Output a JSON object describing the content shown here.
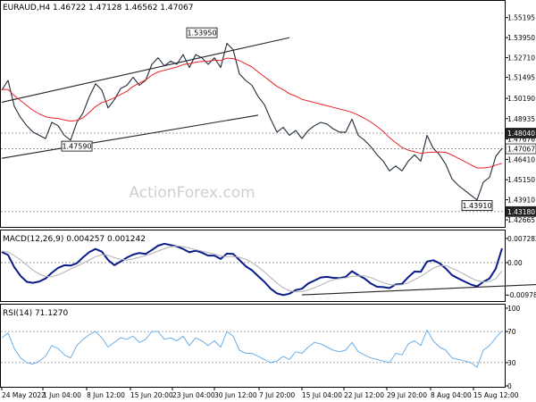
{
  "chart_data": [
    {
      "type": "line",
      "panel": "price",
      "title": "EURAUD,H4 1.46722 1.47128 1.46562 1.47067",
      "watermark": "ActionForex.com",
      "ylim": [
        1.4245,
        1.5595
      ],
      "y_ticks": [
        "1.55195",
        "1.53950",
        "1.52710",
        "1.51495",
        "1.50190",
        "1.48935",
        "1.47676",
        "1.46410",
        "1.45150",
        "1.43910",
        "1.42665"
      ],
      "level_labels": [
        {
          "value": 1.4804,
          "text": "1.48040",
          "style": "dark"
        },
        {
          "value": 1.47067,
          "text": "1.47067",
          "style": "light"
        },
        {
          "value": 1.4318,
          "text": "1.43180",
          "style": "dark"
        }
      ],
      "horizontal_lines": [
        1.4804,
        1.47067,
        1.4318
      ],
      "annotations": [
        {
          "text": "1.53950",
          "x": 32,
          "value": 1.5395
        },
        {
          "text": "1.47590",
          "x": 12,
          "value": 1.4759
        },
        {
          "text": "1.43910",
          "x": 76,
          "value": 1.4391
        }
      ],
      "trendlines": [
        {
          "x": [
            0,
            46
          ],
          "y": [
            1.4995,
            1.5395
          ]
        },
        {
          "x": [
            0,
            41
          ],
          "y": [
            1.4648,
            1.4915
          ]
        }
      ],
      "x_labels": [
        "24 May 2022",
        "1 Jun 04:00",
        "8 Jun 12:00",
        "15 Jun 20:00",
        "23 Jun 04:00",
        "30 Jun 12:00",
        "7 Jul 20:00",
        "15 Jul 04:00",
        "22 Jul 12:00",
        "29 Jul 20:00",
        "8 Aug 04:00",
        "15 Aug 12:00"
      ],
      "series": [
        {
          "name": "EURAUD",
          "color": "#1f2b3b",
          "values": [
            1.507,
            1.513,
            1.497,
            1.49,
            1.485,
            1.481,
            1.479,
            1.477,
            1.487,
            1.485,
            1.479,
            1.476,
            1.487,
            1.493,
            1.503,
            1.511,
            1.507,
            1.496,
            1.501,
            1.508,
            1.51,
            1.515,
            1.51,
            1.513,
            1.523,
            1.527,
            1.522,
            1.525,
            1.523,
            1.529,
            1.521,
            1.529,
            1.527,
            1.523,
            1.527,
            1.521,
            1.536,
            1.532,
            1.517,
            1.513,
            1.51,
            1.503,
            1.498,
            1.489,
            1.481,
            1.484,
            1.479,
            1.482,
            1.477,
            1.482,
            1.485,
            1.487,
            1.486,
            1.483,
            1.481,
            1.481,
            1.489,
            1.479,
            1.476,
            1.472,
            1.467,
            1.463,
            1.457,
            1.46,
            1.457,
            1.463,
            1.467,
            1.463,
            1.479,
            1.471,
            1.467,
            1.461,
            1.452,
            1.448,
            1.445,
            1.442,
            1.439,
            1.45,
            1.453,
            1.466,
            1.471
          ]
        },
        {
          "name": "MA",
          "color": "#e8222a",
          "values": [
            1.5075,
            1.5074,
            1.5036,
            1.5005,
            1.4975,
            1.4945,
            1.4923,
            1.4905,
            1.4898,
            1.4895,
            1.4885,
            1.4878,
            1.4883,
            1.4898,
            1.4933,
            1.4968,
            1.4993,
            1.5005,
            1.5023,
            1.5043,
            1.5063,
            1.5093,
            1.5113,
            1.5133,
            1.5163,
            1.5183,
            1.5193,
            1.5203,
            1.5213,
            1.5228,
            1.5233,
            1.5243,
            1.5248,
            1.5248,
            1.5256,
            1.5253,
            1.5268,
            1.5265,
            1.5253,
            1.5233,
            1.5213,
            1.5183,
            1.5153,
            1.5123,
            1.5093,
            1.5073,
            1.5048,
            1.5033,
            1.5013,
            1.5003,
            1.4993,
            1.4983,
            1.4973,
            1.4963,
            1.4953,
            1.4943,
            1.4933,
            1.4915,
            1.4895,
            1.4873,
            1.4845,
            1.4815,
            1.4775,
            1.4745,
            1.4715,
            1.4698,
            1.4688,
            1.4678,
            1.4684,
            1.4686,
            1.4687,
            1.4685,
            1.4668,
            1.4648,
            1.4628,
            1.4608,
            1.4588,
            1.4588,
            1.4593,
            1.4606,
            1.4617
          ]
        }
      ]
    },
    {
      "type": "line",
      "panel": "macd",
      "title": "MACD(12,26,9) 0.004257 0.001242",
      "ylim": [
        -0.0108,
        0.0078
      ],
      "y_ticks": [
        "0.007282",
        "0.00",
        "-0.009787"
      ],
      "horizontal_lines": [
        0
      ],
      "trendlines": [
        {
          "x": [
            48,
            90
          ],
          "y": [
            -0.00975,
            -0.00625
          ]
        }
      ],
      "series": [
        {
          "name": "MACD",
          "color": "#0a1a8a",
          "values": [
            0.0032,
            0.0023,
            -0.0014,
            -0.004,
            -0.0058,
            -0.0061,
            -0.0057,
            -0.0048,
            -0.0031,
            -0.0016,
            -0.0008,
            -0.0009,
            -0.0002,
            0.0016,
            0.0032,
            0.0041,
            0.0033,
            0.0008,
            -0.0008,
            0.0003,
            0.0015,
            0.0024,
            0.0029,
            0.0026,
            0.0038,
            0.0051,
            0.0057,
            0.0053,
            0.0049,
            0.0041,
            0.0031,
            0.0036,
            0.003,
            0.0021,
            0.0021,
            0.0011,
            0.0027,
            0.0026,
            0.0008,
            -0.0011,
            -0.0023,
            -0.0041,
            -0.0058,
            -0.0079,
            -0.0093,
            -0.0098,
            -0.0094,
            -0.0083,
            -0.0079,
            -0.0063,
            -0.0054,
            -0.0045,
            -0.0043,
            -0.0046,
            -0.0047,
            -0.0043,
            -0.0026,
            -0.0038,
            -0.0048,
            -0.0063,
            -0.0073,
            -0.0074,
            -0.0077,
            -0.0066,
            -0.0064,
            -0.0044,
            -0.0027,
            -0.0028,
            0.0003,
            0.0007,
            -0.0002,
            -0.0018,
            -0.0038,
            -0.0048,
            -0.0057,
            -0.0066,
            -0.0072,
            -0.0058,
            -0.0048,
            -0.0018,
            0.0043
          ]
        },
        {
          "name": "Signal",
          "color": "#b0b0b0",
          "values": [
            0.0035,
            0.0032,
            0.0021,
            0.0008,
            -0.0007,
            -0.0023,
            -0.0035,
            -0.0042,
            -0.0043,
            -0.0037,
            -0.0029,
            -0.0019,
            -0.0011,
            -0.0002,
            0.0008,
            0.0018,
            0.0024,
            0.0022,
            0.0015,
            0.001,
            0.0008,
            0.0011,
            0.0016,
            0.0021,
            0.0027,
            0.0035,
            0.0042,
            0.0048,
            0.005,
            0.0048,
            0.0044,
            0.0039,
            0.0035,
            0.003,
            0.0026,
            0.002,
            0.0018,
            0.0018,
            0.0016,
            0.001,
            0.0,
            -0.0013,
            -0.0028,
            -0.0045,
            -0.0062,
            -0.0076,
            -0.0085,
            -0.0088,
            -0.0087,
            -0.0083,
            -0.0076,
            -0.0068,
            -0.0059,
            -0.0052,
            -0.0048,
            -0.0046,
            -0.0042,
            -0.004,
            -0.004,
            -0.0045,
            -0.0053,
            -0.0061,
            -0.0066,
            -0.0068,
            -0.0067,
            -0.0061,
            -0.0051,
            -0.0042,
            -0.0029,
            -0.0017,
            -0.001,
            -0.0009,
            -0.0017,
            -0.0026,
            -0.0036,
            -0.0046,
            -0.0055,
            -0.0058,
            -0.0057,
            -0.0049,
            -0.0025
          ]
        }
      ]
    },
    {
      "type": "line",
      "panel": "rsi",
      "title": "RSI(14) 71.1270",
      "ylim": [
        0,
        100
      ],
      "y_ticks": [
        "100",
        "70",
        "30",
        "0"
      ],
      "horizontal_lines": [
        70,
        30
      ],
      "series": [
        {
          "name": "RSI",
          "color": "#6aaee8",
          "values": [
            62,
            68,
            48,
            36,
            30,
            28,
            32,
            38,
            52,
            48,
            40,
            36,
            52,
            60,
            66,
            70,
            62,
            50,
            56,
            62,
            60,
            64,
            56,
            60,
            70,
            70,
            60,
            62,
            58,
            64,
            52,
            62,
            58,
            52,
            58,
            50,
            70,
            64,
            46,
            42,
            42,
            38,
            34,
            30,
            32,
            38,
            34,
            44,
            42,
            50,
            56,
            54,
            50,
            46,
            44,
            46,
            56,
            44,
            40,
            36,
            34,
            32,
            30,
            42,
            40,
            54,
            58,
            52,
            72,
            58,
            50,
            46,
            36,
            34,
            32,
            30,
            24,
            46,
            52,
            62,
            71
          ]
        }
      ]
    }
  ]
}
